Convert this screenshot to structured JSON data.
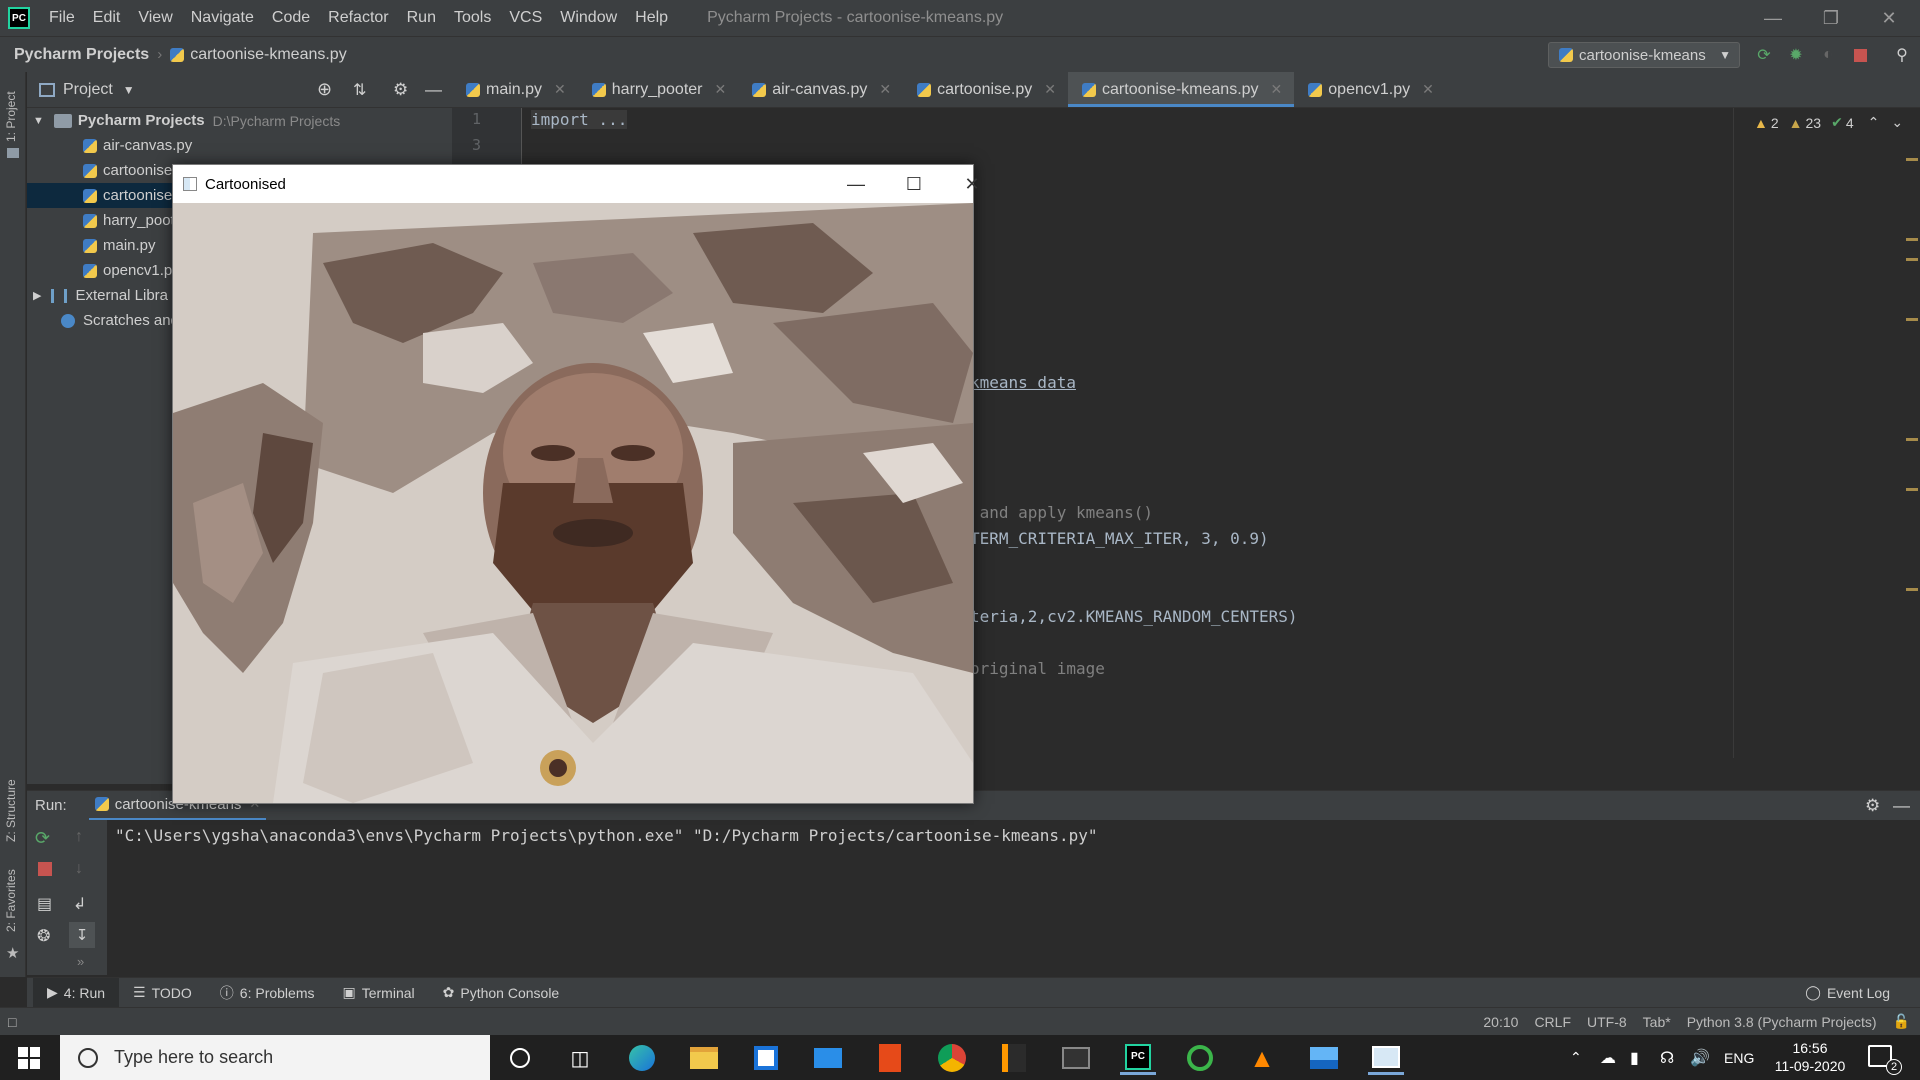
{
  "menubar": {
    "items": [
      "File",
      "Edit",
      "View",
      "Navigate",
      "Code",
      "Refactor",
      "Run",
      "Tools",
      "VCS",
      "Window",
      "Help"
    ],
    "title": "Pycharm Projects - cartoonise-kmeans.py"
  },
  "navbar": {
    "project": "Pycharm Projects",
    "file": "cartoonise-kmeans.py",
    "run_config": "cartoonise-kmeans"
  },
  "project_panel": {
    "header": "Project",
    "root_name": "Pycharm Projects",
    "root_path": "D:\\Pycharm Projects",
    "files": [
      "air-canvas.py",
      "cartoonise",
      "cartoonise",
      "harry_poot",
      "main.py",
      "opencv1.p"
    ],
    "external": "External Libra",
    "scratches": "Scratches and"
  },
  "tabs": [
    "main.py",
    "harry_pooter",
    "air-canvas.py",
    "cartoonise.py",
    "cartoonise-kmeans.py",
    "opencv1.py"
  ],
  "editor": {
    "line1": "1",
    "line3": "3",
    "code_import": "import ...",
    "frag_kmeans_data": "kmeans data",
    "frag_apply": " and apply kmeans()",
    "frag_criteria": "TERM_CRITERIA_MAX_ITER, 3, 0.9)",
    "frag_random": "teria,2,cv2.KMEANS_RANDOM_CENTERS)",
    "frag_original": "original image",
    "warn1": "2",
    "warn2": "23",
    "ok": "4"
  },
  "cv_window": {
    "title": "Cartoonised"
  },
  "left_strip": {
    "project_label": "1: Project",
    "structure_label": "Z: Structure",
    "favorites_label": "2: Favorites"
  },
  "run_panel": {
    "label": "Run:",
    "tab": "cartoonise-kmeans",
    "command": "\"C:\\Users\\ygsha\\anaconda3\\envs\\Pycharm Projects\\python.exe\" \"D:/Pycharm Projects/cartoonise-kmeans.py\""
  },
  "tool_windows": {
    "run": "4: Run",
    "todo": "TODO",
    "problems": "6: Problems",
    "terminal": "Terminal",
    "console": "Python Console",
    "event_log": "Event Log"
  },
  "status": {
    "position": "20:10",
    "line_sep": "CRLF",
    "encoding": "UTF-8",
    "indent": "Tab*",
    "interpreter": "Python 3.8 (Pycharm Projects)"
  },
  "taskbar": {
    "search_placeholder": "Type here to search",
    "lang": "ENG",
    "time": "16:56",
    "date": "11-09-2020",
    "notifications": "2"
  }
}
